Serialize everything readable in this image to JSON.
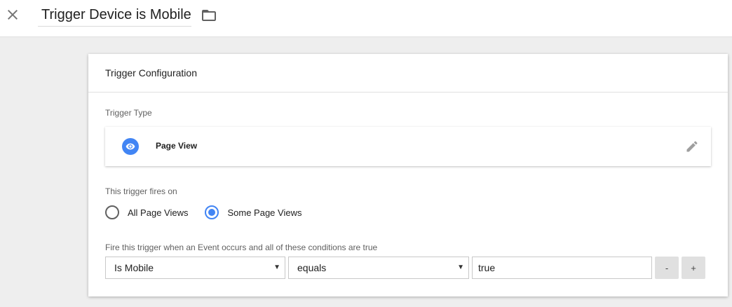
{
  "header": {
    "title": "Trigger Device is Mobile",
    "close_icon": "close-icon",
    "folder_icon": "folder-icon"
  },
  "card": {
    "title": "Trigger Configuration",
    "trigger_type_label": "Trigger Type",
    "trigger_type": {
      "name": "Page View",
      "icon": "eye-icon",
      "icon_color": "#4285f4",
      "edit_icon": "pencil-icon"
    },
    "fires_on_label": "This trigger fires on",
    "fires_on_options": [
      {
        "label": "All Page Views",
        "checked": false
      },
      {
        "label": "Some Page Views",
        "checked": true
      }
    ],
    "condition_label": "Fire this trigger when an Event occurs and all of these conditions are true",
    "condition": {
      "variable": "Is Mobile",
      "operator": "equals",
      "value": "true",
      "remove_label": "-",
      "add_label": "+"
    }
  },
  "colors": {
    "accent": "#4285f4",
    "background": "#eeeeee"
  }
}
